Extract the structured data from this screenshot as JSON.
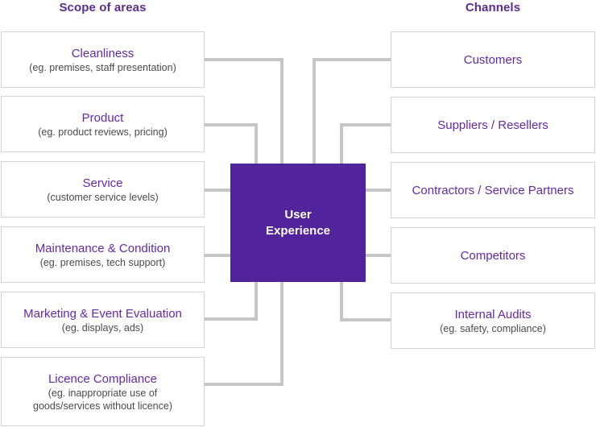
{
  "diagram": {
    "type": "hub-and-spoke",
    "center": {
      "label": "User\nExperience",
      "color": "#52249b",
      "text_color": "#ffffff"
    },
    "left_column": {
      "heading": "Scope of areas",
      "heading_color": "#5b2d90",
      "items": [
        {
          "title": "Cleanliness",
          "subtitle": [
            "(eg. premises, staff presentation)"
          ]
        },
        {
          "title": "Product",
          "subtitle": [
            "(eg. product reviews, pricing)"
          ]
        },
        {
          "title": "Service",
          "subtitle": [
            "(customer service levels)"
          ]
        },
        {
          "title": "Maintenance & Condition",
          "subtitle": [
            "(eg. premises, tech support)"
          ]
        },
        {
          "title": "Marketing & Event Evaluation",
          "subtitle": [
            "(eg. displays, ads)"
          ]
        },
        {
          "title": "Licence Compliance",
          "subtitle": [
            "(eg. inappropriate use of",
            "goods/services without licence)"
          ]
        }
      ]
    },
    "right_column": {
      "heading": "Channels",
      "heading_color": "#5b2d90",
      "items": [
        {
          "title": "Customers",
          "subtitle": []
        },
        {
          "title": "Suppliers / Resellers",
          "subtitle": []
        },
        {
          "title": "Contractors / Service Partners",
          "subtitle": []
        },
        {
          "title": "Competitors",
          "subtitle": []
        },
        {
          "title": "Internal Audits",
          "subtitle": [
            "(eg. safety, compliance)"
          ]
        }
      ]
    },
    "connector_color": "#c6c6c6",
    "box_border_color": "#d3d3d3",
    "title_color": "#6529a8",
    "subtitle_color": "#4a4a4a"
  }
}
